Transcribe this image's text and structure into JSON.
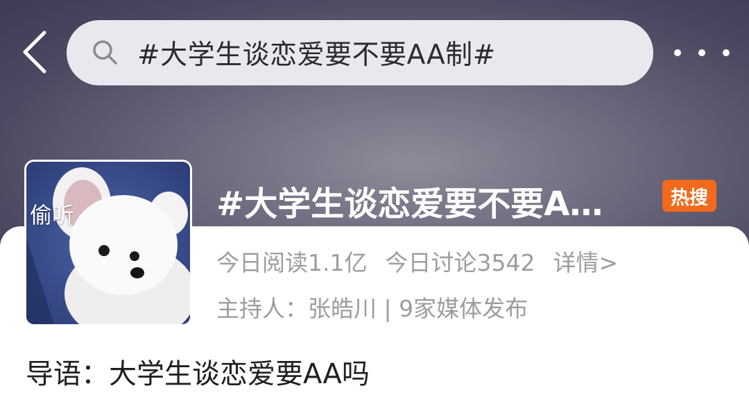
{
  "search": {
    "query": "#大学生谈恋爱要不要AA制#"
  },
  "topic": {
    "title": "#大学生谈恋爱要不要A…",
    "badge": "热搜",
    "avatar_caption": "偷听",
    "reads": "今日阅读1.1亿",
    "discussions": "今日讨论3542",
    "details_link": "详情>",
    "host_line": "主持人：张皓川 | 9家媒体发布"
  },
  "intro": {
    "text": "导语：大学生谈恋爱要AA吗"
  },
  "icons": [
    "back-arrow-icon",
    "search-icon",
    "more-icon",
    "puppy-avatar-image"
  ],
  "colors": {
    "header_bg": "#5a586e",
    "search_bg": "#e9e8ee",
    "hot_badge": "#f26a1b",
    "secondary_text": "#9c9ca2",
    "primary_text": "#1f1f22"
  }
}
